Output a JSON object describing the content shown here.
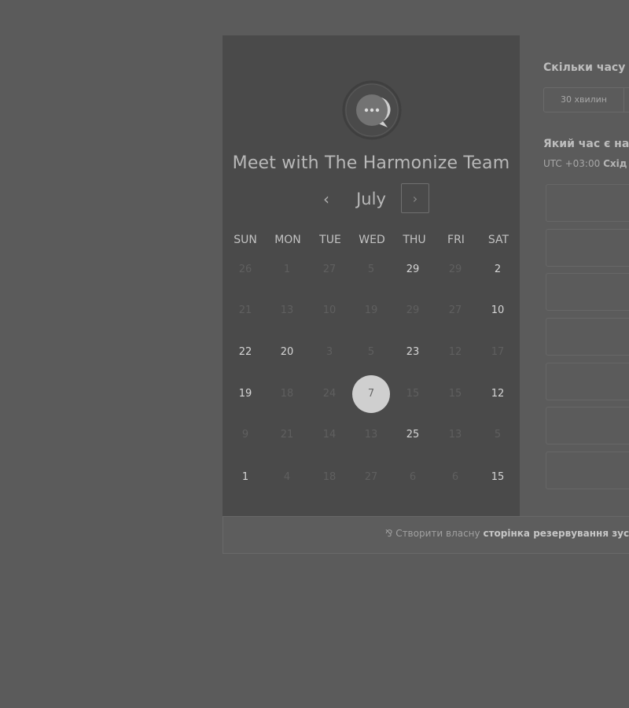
{
  "calendar": {
    "title": "Meet with The Harmonize Team",
    "month": "July",
    "prev_icon": "‹",
    "next_icon": "›",
    "weekdays": [
      "SUN",
      "MON",
      "TUE",
      "WED",
      "THU",
      "FRI",
      "SAT"
    ],
    "weeks": [
      [
        {
          "d": "26",
          "on": false
        },
        {
          "d": "1",
          "on": false
        },
        {
          "d": "27",
          "on": false
        },
        {
          "d": "5",
          "on": false
        },
        {
          "d": "29",
          "on": true
        },
        {
          "d": "29",
          "on": false
        },
        {
          "d": "2",
          "on": true
        }
      ],
      [
        {
          "d": "21",
          "on": false
        },
        {
          "d": "13",
          "on": false
        },
        {
          "d": "10",
          "on": false
        },
        {
          "d": "19",
          "on": false
        },
        {
          "d": "29",
          "on": false
        },
        {
          "d": "27",
          "on": false
        },
        {
          "d": "10",
          "on": true
        }
      ],
      [
        {
          "d": "22",
          "on": true
        },
        {
          "d": "20",
          "on": true
        },
        {
          "d": "3",
          "on": false
        },
        {
          "d": "5",
          "on": false
        },
        {
          "d": "23",
          "on": true
        },
        {
          "d": "12",
          "on": false
        },
        {
          "d": "17",
          "on": false
        }
      ],
      [
        {
          "d": "19",
          "on": true
        },
        {
          "d": "18",
          "on": false
        },
        {
          "d": "24",
          "on": false
        },
        {
          "d": "7",
          "on": true,
          "selected": true
        },
        {
          "d": "15",
          "on": false
        },
        {
          "d": "15",
          "on": false
        },
        {
          "d": "12",
          "on": true
        }
      ],
      [
        {
          "d": "9",
          "on": false
        },
        {
          "d": "21",
          "on": false
        },
        {
          "d": "14",
          "on": false
        },
        {
          "d": "13",
          "on": false
        },
        {
          "d": "25",
          "on": true
        },
        {
          "d": "13",
          "on": false
        },
        {
          "d": "5",
          "on": false
        }
      ],
      [
        {
          "d": "1",
          "on": true
        },
        {
          "d": "4",
          "on": false
        },
        {
          "d": "18",
          "on": false
        },
        {
          "d": "27",
          "on": false
        },
        {
          "d": "6",
          "on": false
        },
        {
          "d": "6",
          "on": false
        },
        {
          "d": "15",
          "on": true
        }
      ]
    ]
  },
  "booking": {
    "duration_question": "Скільки часу в",
    "duration_option": "30 хвилин",
    "time_question": "Який час є най",
    "timezone_offset": "UTC +03:00",
    "timezone_name": "Схід"
  },
  "footer": {
    "icon": "⅋",
    "text_prefix": "Створити власну",
    "text_bold": "сторінка резервування зустр"
  },
  "colors": {
    "background": "#5b5b5b",
    "panel": "#4a4a4a",
    "selected_day": "#cfcfcf"
  }
}
